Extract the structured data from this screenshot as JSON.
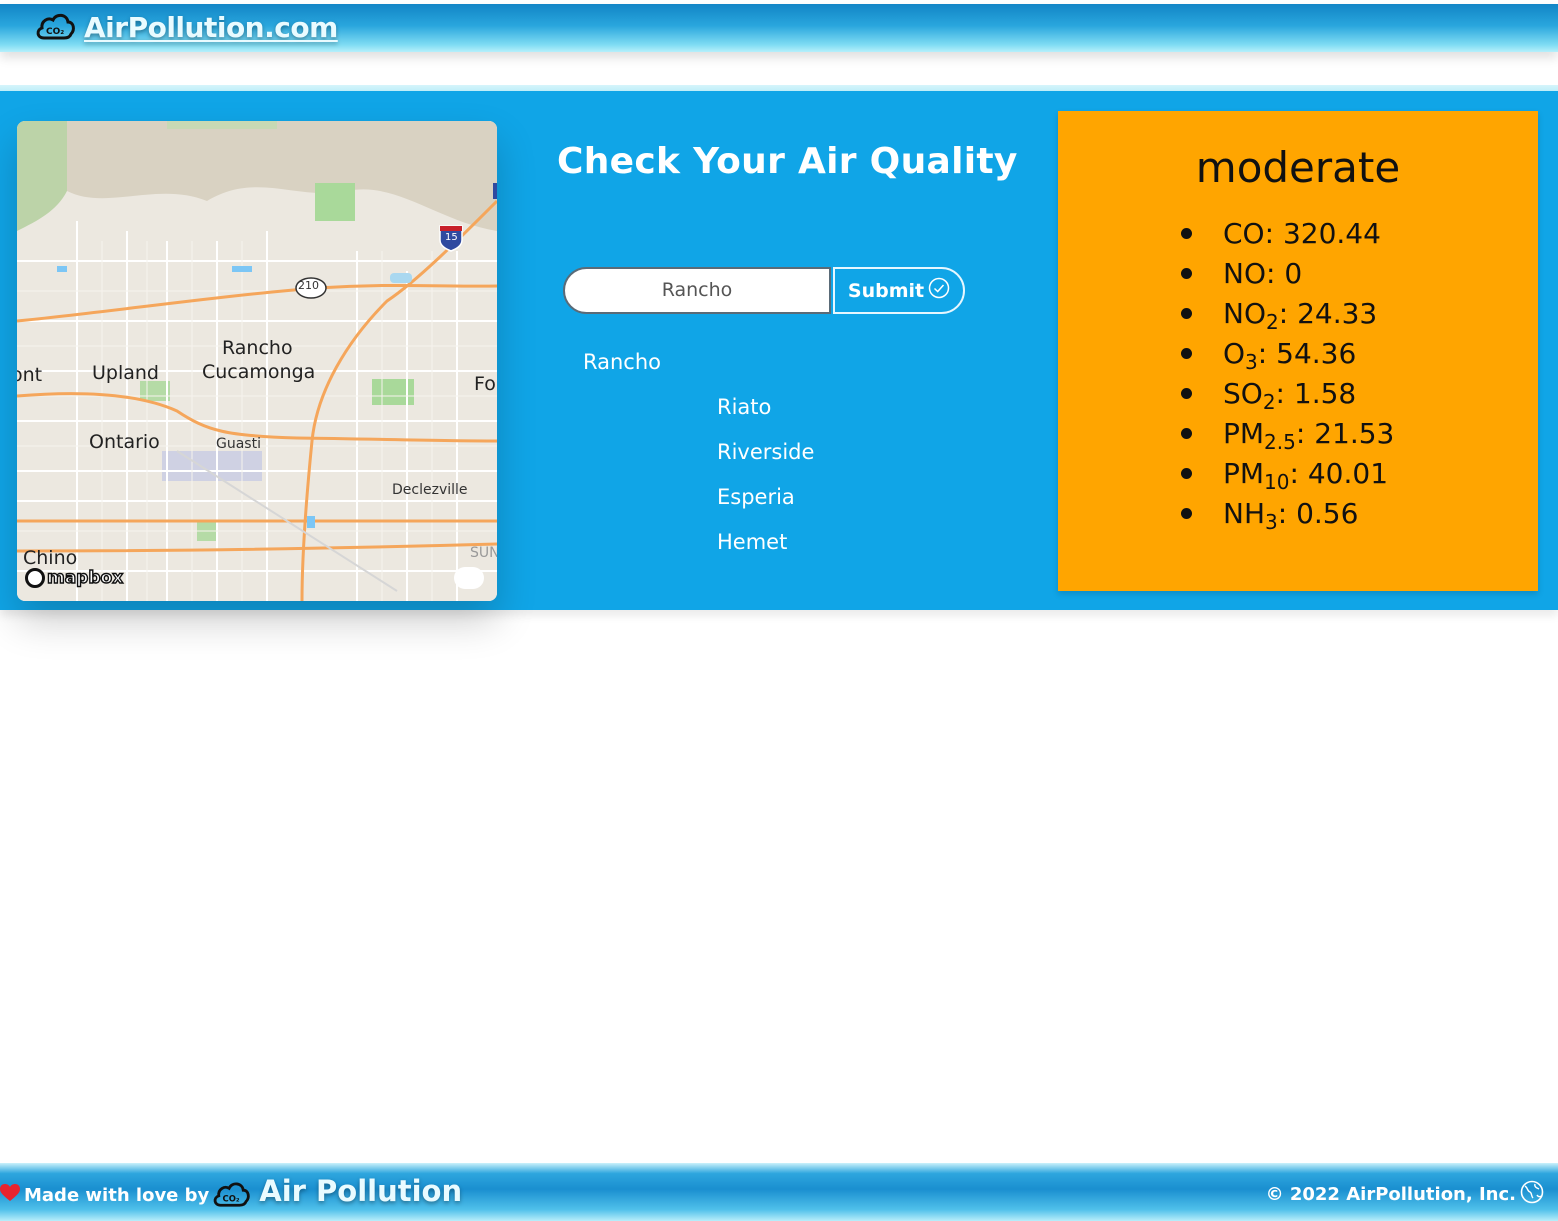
{
  "header": {
    "brand": "AirPollution.com",
    "logo_icon": "co2-cloud-icon"
  },
  "map": {
    "labels": {
      "upland": "Upland",
      "rancho": "Rancho",
      "cucamonga": "Cucamonga",
      "ontario": "Ontario",
      "guasti": "Guasti",
      "declezville": "Declezville",
      "chino": "Chino",
      "fo": "Fo",
      "ont": "ont",
      "sun": "SUN",
      "route210": "210",
      "i15": "15"
    },
    "attribution": "mapbox"
  },
  "search": {
    "title": "Check Your Air Quality",
    "input_value": "Rancho",
    "submit_label": "Submit",
    "suggestions": [
      "Rancho",
      "Riato",
      "Riverside",
      "Esperia",
      "Hemet"
    ]
  },
  "air_quality": {
    "level": "moderate",
    "color": "#ffa500",
    "pollutants": [
      {
        "name": "CO",
        "sub": "",
        "value": "320.44"
      },
      {
        "name": "NO",
        "sub": "",
        "value": "0"
      },
      {
        "name": "NO",
        "sub": "2",
        "value": "24.33"
      },
      {
        "name": "O",
        "sub": "3",
        "value": "54.36"
      },
      {
        "name": "SO",
        "sub": "2",
        "value": "1.58"
      },
      {
        "name": "PM",
        "sub": "2.5",
        "value": "21.53"
      },
      {
        "name": "PM",
        "sub": "10",
        "value": "40.01"
      },
      {
        "name": "NH",
        "sub": "3",
        "value": "0.56"
      }
    ]
  },
  "footer": {
    "made_with": "Made with love by",
    "brand": "Air Pollution",
    "copyright": "© 2022 AirPollution, Inc."
  }
}
